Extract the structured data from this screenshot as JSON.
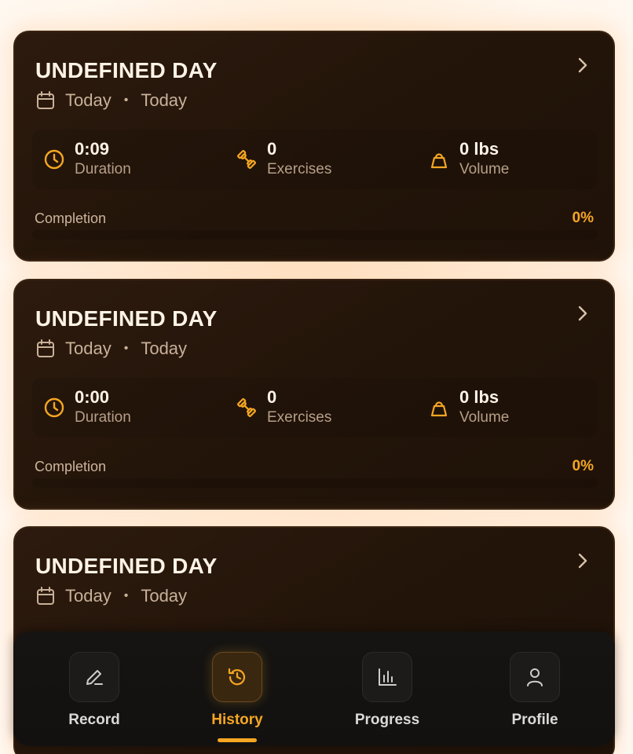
{
  "workouts": [
    {
      "title": "UNDEFINED DAY",
      "date_start": "Today",
      "date_end": "Today",
      "duration_value": "0:09",
      "duration_label": "Duration",
      "exercises_value": "0",
      "exercises_label": "Exercises",
      "volume_value": "0 lbs",
      "volume_label": "Volume",
      "completion_label": "Completion",
      "completion_pct": "0%"
    },
    {
      "title": "UNDEFINED DAY",
      "date_start": "Today",
      "date_end": "Today",
      "duration_value": "0:00",
      "duration_label": "Duration",
      "exercises_value": "0",
      "exercises_label": "Exercises",
      "volume_value": "0 lbs",
      "volume_label": "Volume",
      "completion_label": "Completion",
      "completion_pct": "0%"
    },
    {
      "title": "UNDEFINED DAY",
      "date_start": "Today",
      "date_end": "Today"
    }
  ],
  "nav": {
    "items": [
      {
        "label": "Record",
        "icon": "pencil-icon"
      },
      {
        "label": "History",
        "icon": "history-icon"
      },
      {
        "label": "Progress",
        "icon": "bar-chart-icon"
      },
      {
        "label": "Profile",
        "icon": "user-icon"
      }
    ],
    "active": "History"
  },
  "colors": {
    "accent": "#f5a623",
    "card_bg": "#2d1a0e",
    "nav_bg": "#161412",
    "text_primary": "#fff3e6",
    "text_muted": "#b79f88"
  }
}
